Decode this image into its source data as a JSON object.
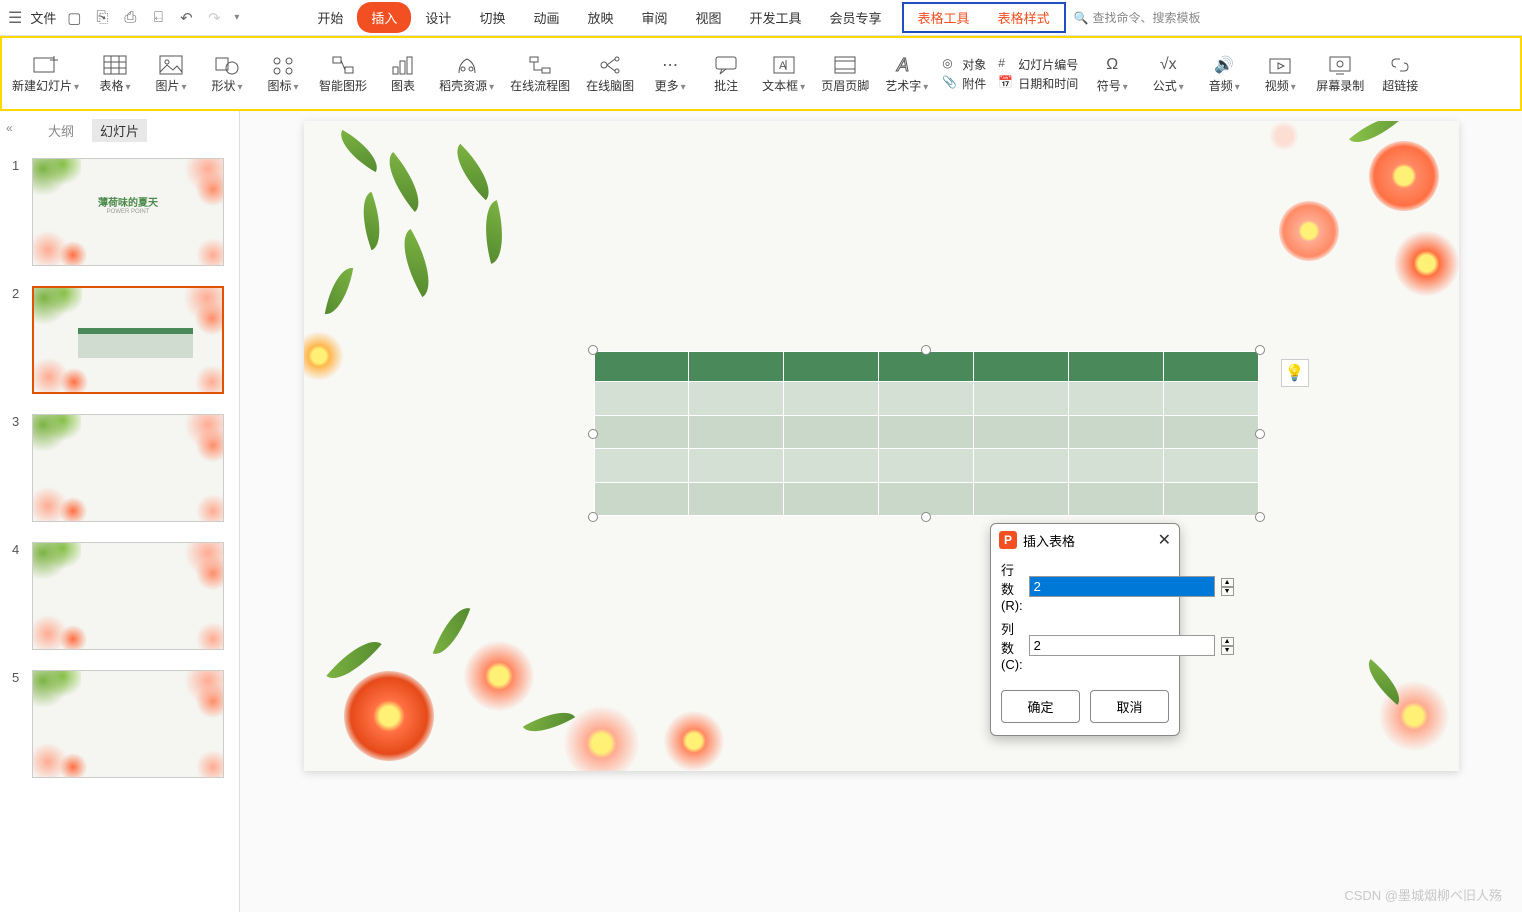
{
  "topbar": {
    "file_label": "文件",
    "qat": [
      "save-icon",
      "export-icon",
      "print-icon",
      "print-preview-icon",
      "undo-icon",
      "redo-icon"
    ]
  },
  "ribbon_tabs": [
    "开始",
    "插入",
    "设计",
    "切换",
    "动画",
    "放映",
    "审阅",
    "视图",
    "开发工具",
    "会员专享"
  ],
  "ribbon_tab_active": "插入",
  "context_tabs": [
    "表格工具",
    "表格样式"
  ],
  "search_placeholder": "查找命令、搜索模板",
  "ribbon": {
    "new_slide": "新建幻灯片",
    "table": "表格",
    "picture": "图片",
    "shapes": "形状",
    "icons": "图标",
    "smartart": "智能图形",
    "chart": "图表",
    "docer": "稻壳资源",
    "flowchart": "在线流程图",
    "mindmap": "在线脑图",
    "more": "更多",
    "comment": "批注",
    "textbox": "文本框",
    "header_footer": "页眉页脚",
    "wordart": "艺术字",
    "object": "对象",
    "slide_number": "幻灯片编号",
    "attachment": "附件",
    "datetime": "日期和时间",
    "symbol": "符号",
    "equation": "公式",
    "audio": "音频",
    "video": "视频",
    "screen_record": "屏幕录制",
    "hyperlink": "超链接"
  },
  "sidebar": {
    "view_outline": "大纲",
    "view_slides": "幻灯片",
    "slide1_title": "薄荷味的夏天",
    "slide1_subtitle": "POWER POINT",
    "thumbs": [
      1,
      2,
      3,
      4,
      5
    ]
  },
  "dialog": {
    "title": "插入表格",
    "rows_label": "行数(R):",
    "rows_value": "2",
    "cols_label": "列数(C):",
    "cols_value": "2",
    "ok": "确定",
    "cancel": "取消"
  },
  "watermark": "CSDN @墨城烟柳ベ旧人殇"
}
